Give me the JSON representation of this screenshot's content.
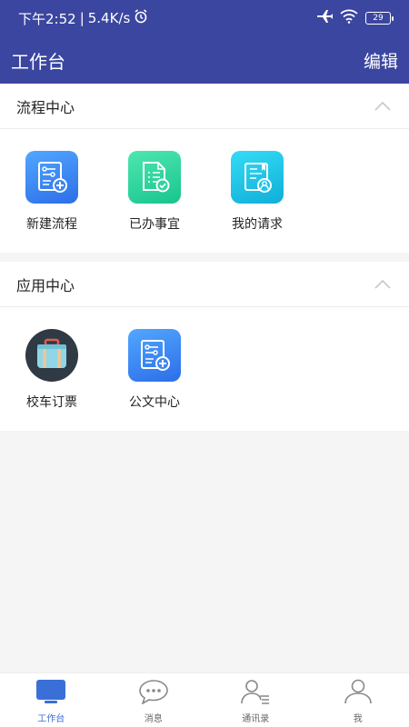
{
  "status_bar": {
    "time": "下午2:52",
    "separator": "|",
    "speed": "5.4K/s",
    "battery": "29"
  },
  "header": {
    "title": "工作台",
    "edit_label": "编辑"
  },
  "sections": [
    {
      "title": "流程中心",
      "items": [
        {
          "label": "新建流程",
          "icon": "new-process-icon"
        },
        {
          "label": "已办事宜",
          "icon": "done-tasks-icon"
        },
        {
          "label": "我的请求",
          "icon": "my-requests-icon"
        }
      ]
    },
    {
      "title": "应用中心",
      "items": [
        {
          "label": "校车订票",
          "icon": "luggage-icon"
        },
        {
          "label": "公文中心",
          "icon": "document-center-icon"
        }
      ]
    }
  ],
  "tabs": [
    {
      "label": "工作台",
      "icon": "monitor-icon",
      "active": true
    },
    {
      "label": "消息",
      "icon": "chat-bubble-icon",
      "active": false
    },
    {
      "label": "通讯录",
      "icon": "contacts-icon",
      "active": false
    },
    {
      "label": "我",
      "icon": "person-icon",
      "active": false
    }
  ],
  "colors": {
    "header_bg": "#3b46a0",
    "tab_active": "#3b6fd8",
    "blue_tile": "#3f86f0",
    "green_tile": "#2cd59f",
    "cyan_tile": "#1fc4e6"
  }
}
